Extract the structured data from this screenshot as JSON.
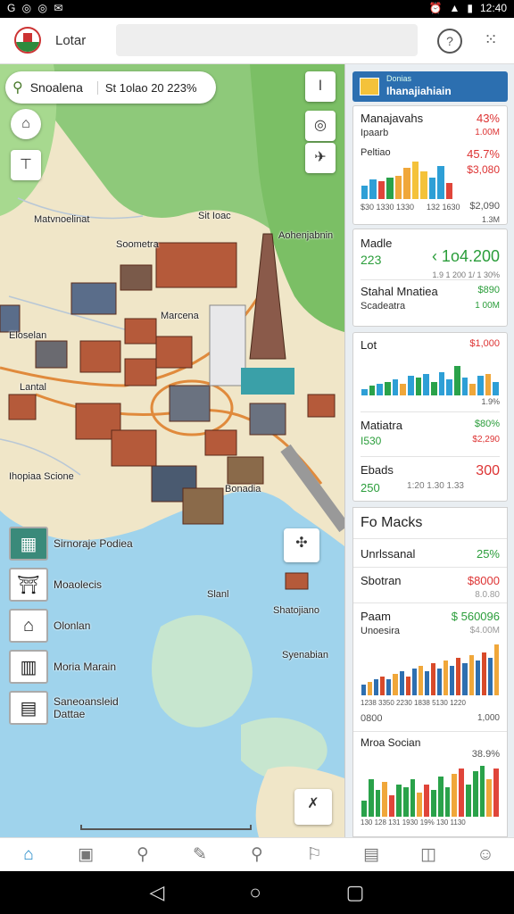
{
  "status_bar": {
    "left_icons": "G ◎ ◎ ✉",
    "time": "12:40"
  },
  "app": {
    "title": "Lotar",
    "logo": "app-logo-icon"
  },
  "map": {
    "search_label": "Snoalena",
    "search_value": "St 1olao 20 223%",
    "labels": {
      "a": "Matvnoelinat",
      "b": "Sit Ioac",
      "c": "Soometra",
      "d": "Aohenjabnin",
      "e": "Marcena",
      "f": "Eloselan",
      "g": "Lantal",
      "h": "Ihopiaa Scione",
      "i": "Bonadia",
      "j": "Slanl",
      "k": "Shatojiano",
      "l": "Syenabian"
    },
    "layers": [
      {
        "label": "Sirnoraje Podiea",
        "icon": "map-layer-icon"
      },
      {
        "label": "Moaolecis",
        "icon": "temple-icon"
      },
      {
        "label": "Olonlan",
        "icon": "pagoda-icon"
      },
      {
        "label": "Moria Marain",
        "icon": "building-icon"
      },
      {
        "label": "Saneoansleid Dattae",
        "icon": "warehouse-icon"
      }
    ],
    "controls": {
      "compass": "compass-icon",
      "locate": "locate-icon",
      "info": "info-icon",
      "layers": "layers-icon",
      "route": "route-icon",
      "expand": "expand-icon"
    }
  },
  "panel": {
    "header": {
      "title": "Ihanajiahiain",
      "subtitle": "Donias"
    },
    "card1": {
      "title": "Manajavahs",
      "value": "43%",
      "sub_left": "Ipaarb",
      "sub_right": "1.00M",
      "row2_label": "Peltiao",
      "row2_value": "45.7%",
      "row2_sub": "$3,080",
      "ticks_left": "$30  1330 1330",
      "ticks_mid": "132 1630",
      "tick_val": "$2,090",
      "tick_sub": "1.3M",
      "chart_colors": [
        "#2e9fd6",
        "#2e9fd6",
        "#e0453a",
        "#2aa24a",
        "#f0a73a",
        "#f0a73a",
        "#f4c23a",
        "#f4c23a"
      ],
      "chart_values": [
        0.35,
        0.5,
        0.45,
        0.55,
        0.6,
        0.8,
        0.95,
        0.7,
        0.55,
        0.85,
        0.4
      ]
    },
    "card2": {
      "title": "Madle",
      "value": "223",
      "big": "‹ 1o4.200",
      "sub": "1.9  1 200 1/ 1 30%",
      "row_label": "Stahal Mnatiea",
      "row_value": "$890",
      "row_sub": "Scadeatra",
      "row_sub_value": "1 00M"
    },
    "card3": {
      "title": "Lot",
      "value": "$1,000",
      "chart_values": [
        0.15,
        0.25,
        0.3,
        0.35,
        0.4,
        0.3,
        0.5,
        0.45,
        0.55,
        0.35,
        0.6,
        0.4,
        0.75,
        0.45,
        0.3,
        0.5,
        0.55,
        0.35
      ],
      "chart_colors": [
        "#2e9fd6",
        "#2aa24a",
        "#2e9fd6",
        "#2aa24a",
        "#2e9fd6",
        "#f0a73a",
        "#2e9fd6",
        "#2aa24a",
        "#2e9fd6",
        "#2aa24a",
        "#2e9fd6",
        "#2e9fd6",
        "#2aa24a",
        "#2e9fd6",
        "#f0a73a",
        "#2e9fd6",
        "#f0a73a",
        "#2e9fd6"
      ],
      "tick_val": "1.9%",
      "row1_label": "Matiatra",
      "row1_value": "$80%",
      "row1_sub": "I530",
      "row1_sub_value": "$2,290",
      "row2_label": "Ebads",
      "row2_value": "300",
      "row2_sub": "250",
      "row2_ticks": "1:20 1.30 1.33"
    },
    "metrics": {
      "title": "Fo Macks",
      "rows": [
        {
          "label": "Unrlssanal",
          "value": "25%",
          "color": "green"
        },
        {
          "label": "Sbotran",
          "value": "$8000",
          "sub": "8.0.80",
          "color": "red"
        },
        {
          "label": "Paam",
          "value": "$ 560096",
          "sub": "$4.00M",
          "sublabel": "Unoesira",
          "color": "green"
        }
      ],
      "chart1_ticks": "1238 3350 2230  1838 5130 1220",
      "chart1_bottom_left": "0800",
      "chart1_bottom_right": "1,000",
      "chart2_title": "Mroa Socian",
      "chart2_value": "38.9%",
      "chart2_ticks": "130 128 131 1930 19% 130 1130"
    }
  },
  "bottom_nav": [
    "home-icon",
    "library-icon",
    "search-icon",
    "edit-icon",
    "explore-icon",
    "route-icon",
    "calendar-icon",
    "book-icon",
    "profile-icon"
  ],
  "system_nav": [
    "back-icon",
    "home-circle-icon",
    "recents-icon"
  ]
}
